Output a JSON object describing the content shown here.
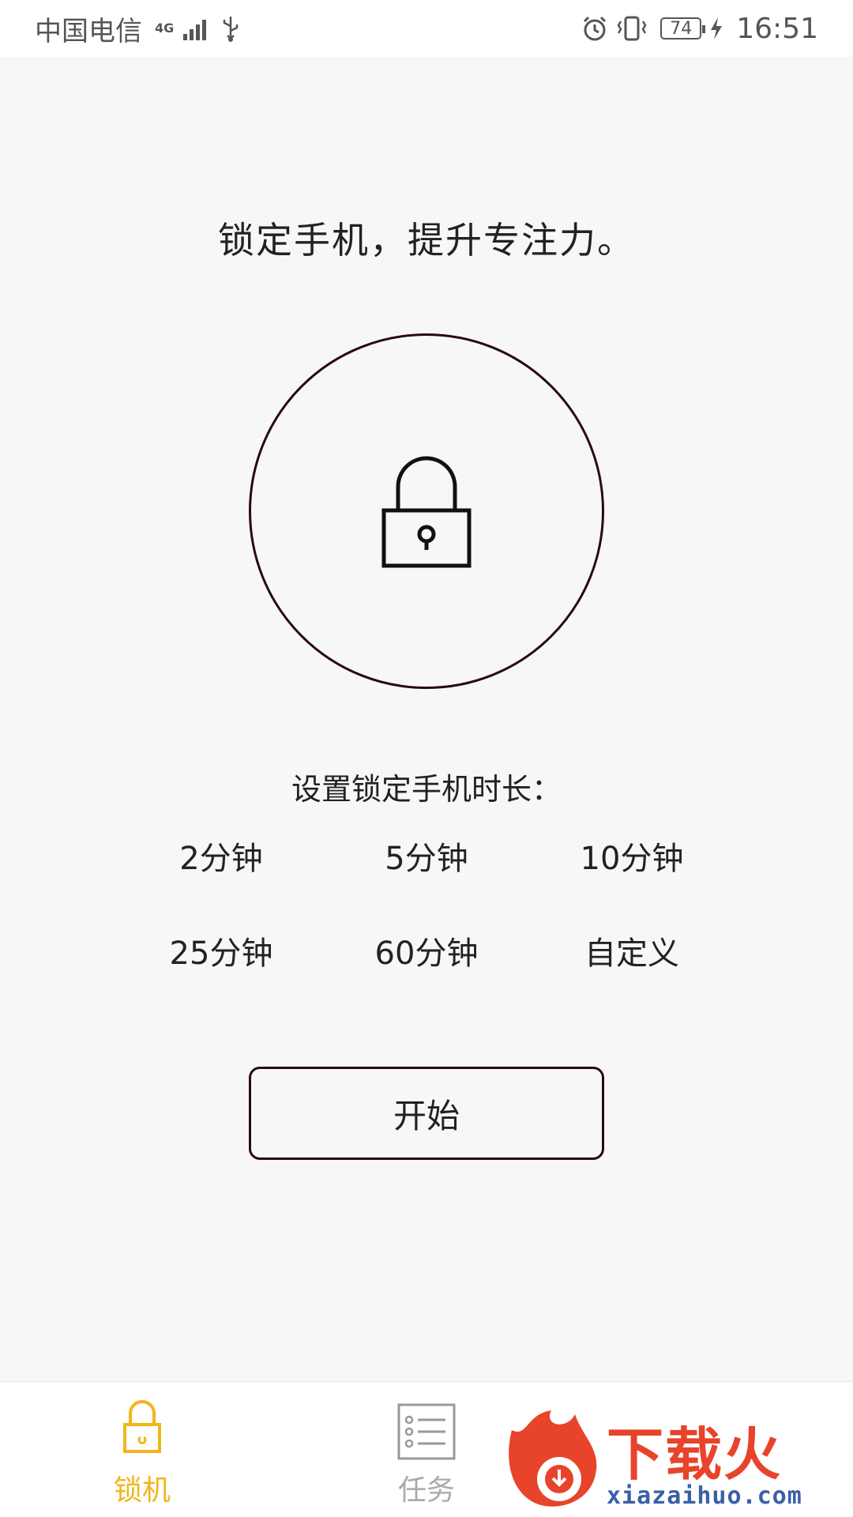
{
  "status_bar": {
    "carrier": "中国电信",
    "network_type": "4G",
    "battery_level": "74",
    "time": "16:51"
  },
  "main": {
    "headline": "锁定手机，提升专注力。",
    "duration_title": "设置锁定手机时长：",
    "duration_options": [
      "2分钟",
      "5分钟",
      "10分钟",
      "25分钟",
      "60分钟",
      "自定义"
    ],
    "start_label": "开始"
  },
  "bottom_nav": {
    "items": [
      {
        "label": "锁机",
        "icon": "lock-icon",
        "active": true
      },
      {
        "label": "任务",
        "icon": "task-list-icon",
        "active": false
      }
    ],
    "active_color": "#f3b51b",
    "inactive_color": "#aaaaaa"
  },
  "watermark": {
    "text": "下载火",
    "url": "xiazaihuo.com"
  }
}
